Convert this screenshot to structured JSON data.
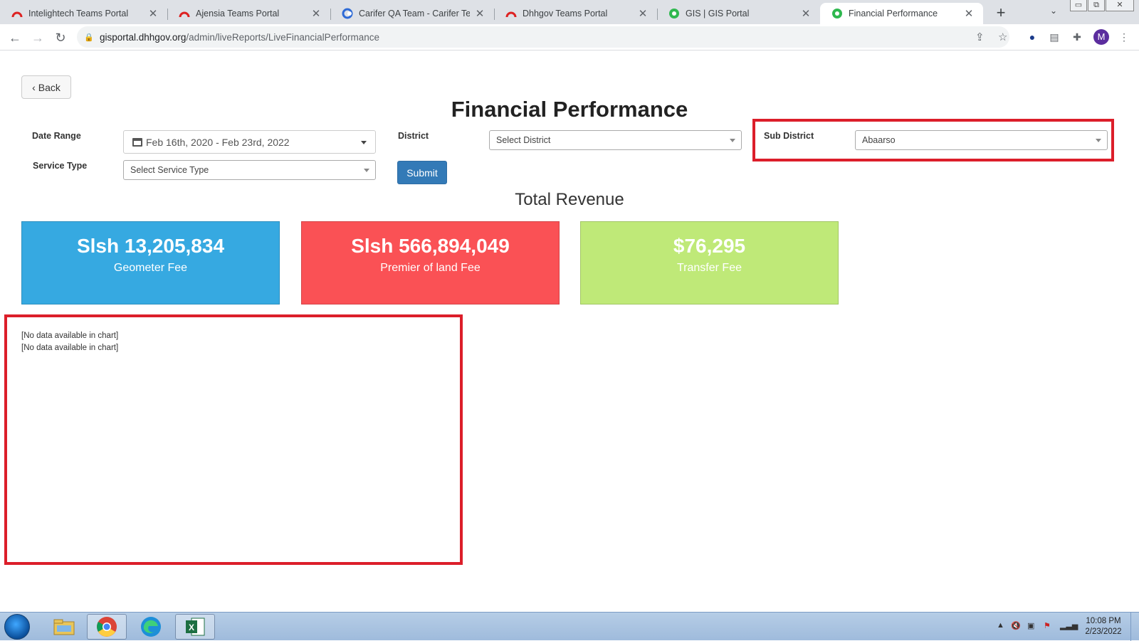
{
  "browser": {
    "tabs": [
      {
        "title": "Intelightech Teams Portal",
        "favicon": "portal-arc-icon",
        "active": false
      },
      {
        "title": "Ajensia Teams Portal",
        "favicon": "portal-arc-icon",
        "active": false
      },
      {
        "title": "Carifer QA Team - Carifer Team",
        "favicon": "carifer-icon",
        "active": false
      },
      {
        "title": "Dhhgov Teams Portal",
        "favicon": "portal-arc-icon",
        "active": false
      },
      {
        "title": "GIS | GIS Portal",
        "favicon": "gis-icon",
        "active": false
      },
      {
        "title": "Financial Performance",
        "favicon": "gis-icon",
        "active": true
      }
    ],
    "url_host": "gisportal.dhhgov.org",
    "url_path": "/admin/liveReports/LiveFinancialPerformance",
    "profile_initial": "M"
  },
  "page": {
    "back_label": "Back",
    "title": "Financial Performance",
    "filters": {
      "date_range_label": "Date Range",
      "date_range_value": "Feb 16th, 2020 - Feb 23rd, 2022",
      "district_label": "District",
      "district_value": "Select District",
      "sub_district_label": "Sub District",
      "sub_district_value": "Abaarso",
      "service_type_label": "Service Type",
      "service_type_value": "Select Service Type",
      "submit_label": "Submit"
    },
    "revenue_title": "Total Revenue",
    "cards": [
      {
        "amount": "Slsh 13,205,834",
        "name": "Geometer Fee",
        "color": "#36a9e1"
      },
      {
        "amount": "Slsh 566,894,049",
        "name": "Premier of land Fee",
        "color": "#fa5155"
      },
      {
        "amount": "$76,295",
        "name": "Transfer Fee",
        "color": "#bfe978"
      }
    ],
    "chart_messages": [
      "[No data available in chart]",
      "[No data available in chart]"
    ],
    "highlight_color": "#dc1e2a"
  },
  "taskbar": {
    "apps": [
      "windows-explorer-icon",
      "chrome-icon",
      "edge-icon",
      "excel-icon"
    ],
    "time": "10:08 PM",
    "date": "2/23/2022"
  }
}
